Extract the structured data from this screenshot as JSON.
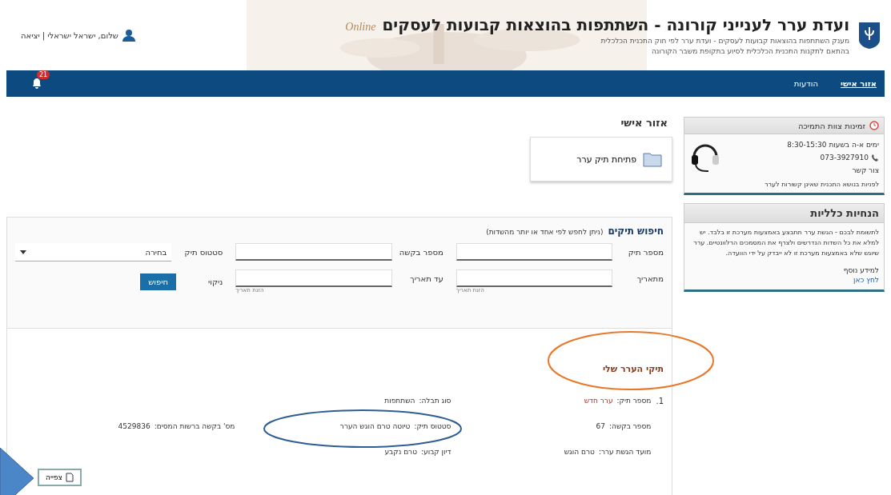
{
  "header": {
    "title": "ועדת ערר לענייני קורונה - השתתפות בהוצאות קבועות לעסקים",
    "tag": "Online",
    "subtitle_1": "מענק השתתפות בהוצאות קבועות לעסקים - ועדת ערר לפי חוק התכנית הכלכלית",
    "subtitle_2": "בהתאם לתקנות התכנית הכלכלית לסיוע בתקופת משבר הקורונה",
    "user": "שלום, ישראל ישראלי | יציאה"
  },
  "nav": {
    "items": [
      {
        "label": "אזור אישי",
        "selected": true
      },
      {
        "label": "הודעות",
        "selected": false
      }
    ],
    "badge": "21"
  },
  "sidebar": {
    "support": {
      "title": "זמינות צוות התמיכה",
      "hours": "ימים א-ה בשעות 8:30-15:30",
      "phone": "073-3927910",
      "mail": "צור קשר",
      "note": "לפניות בנושא התכנית שאינן קשורות לערר"
    },
    "guidelines": {
      "title": "הנחיות כלליות",
      "text": "לתשומת לבכם - הגשת ערר תתבצע באמצעות מערכת זו בלבד. יש למלא את כל השדות הנדרשים ולצרף את המסמכים הרלוונטיים. ערר שיוגש שלא באמצעות מערכת זו לא ייבדק על ידי הוועדה.",
      "link_label": "למידע נוסף",
      "link": "לחץ כאן"
    }
  },
  "personal": {
    "title": "אזור אישי",
    "open_button": "פתיחת תיק ערר"
  },
  "search": {
    "title": "חיפוש תיקים",
    "hint": "(ניתן לחפש לפי אחד או יותר מהשדות)",
    "fields": [
      {
        "label": "מספר תיק",
        "kind": "input"
      },
      {
        "label": "מספר בקשה",
        "kind": "input"
      },
      {
        "label": "סטטוס תיק",
        "kind": "select",
        "value": "בחירה"
      },
      {
        "label": "מתאריך",
        "kind": "input",
        "sub": "הזנת תאריך"
      },
      {
        "label": "עד תאריך",
        "kind": "input",
        "sub": "הזנת תאריך"
      }
    ],
    "clear": "ניקוי",
    "submit": "חיפוש"
  },
  "results": {
    "title": "תיקי הערר שלי",
    "items": [
      {
        "index": "1.",
        "fields": [
          {
            "label": "מספר תיק:",
            "value": "ערר חדש"
          },
          {
            "label": "מספר בקשה:",
            "value": "67"
          },
          {
            "label": "מועד הגשת ערר:",
            "value": "טרם הוגש"
          },
          {
            "label": "סוג תבלה:",
            "value": "השתתפות"
          },
          {
            "label": "סטטוס תיק:",
            "value": "טיוטה טרם הוגש הערר"
          },
          {
            "label": "דיון קבוע:",
            "value": "טרם נקבע"
          },
          {
            "label": "מס' בקשה ברשות המסים:",
            "value": "4529836"
          }
        ],
        "view": "צפייה"
      }
    ]
  }
}
